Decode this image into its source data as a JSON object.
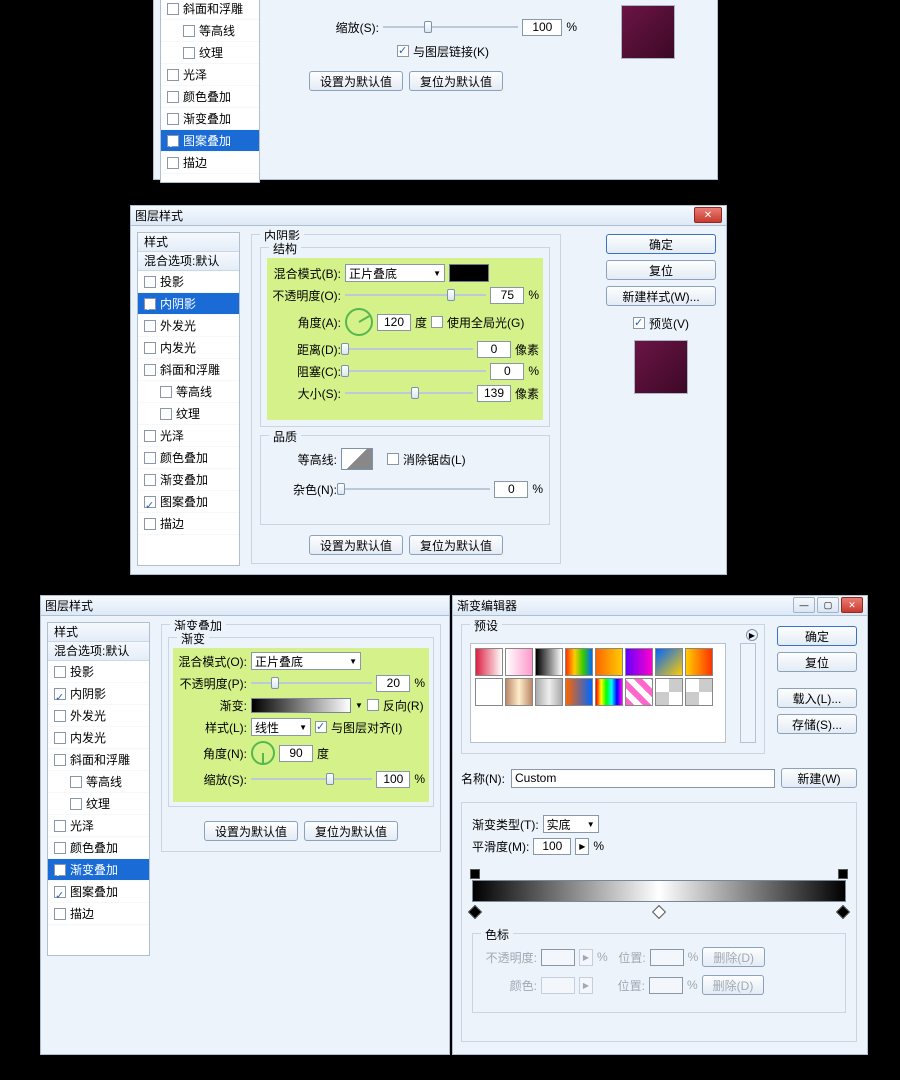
{
  "dlg1": {
    "sidebar": [
      {
        "label": "斜面和浮雕",
        "checked": false,
        "sel": false,
        "indent": false
      },
      {
        "label": "等高线",
        "checked": false,
        "sel": false,
        "indent": true
      },
      {
        "label": "纹理",
        "checked": false,
        "sel": false,
        "indent": true
      },
      {
        "label": "光泽",
        "checked": false,
        "sel": false,
        "indent": false
      },
      {
        "label": "颜色叠加",
        "checked": false,
        "sel": false,
        "indent": false
      },
      {
        "label": "渐变叠加",
        "checked": false,
        "sel": false,
        "indent": false
      },
      {
        "label": "图案叠加",
        "checked": true,
        "sel": true,
        "indent": false
      },
      {
        "label": "描边",
        "checked": false,
        "sel": false,
        "indent": false
      }
    ],
    "scale_label": "缩放(S):",
    "scale_value": "100",
    "pct": "%",
    "link_label": "与图层链接(K)",
    "reset_default": "设置为默认值",
    "restore_default": "复位为默认值"
  },
  "dlg2": {
    "title": "图层样式",
    "styles_label": "样式",
    "blend_default": "混合选项:默认",
    "effects": [
      {
        "label": "投影",
        "checked": false,
        "sel": false,
        "indent": false
      },
      {
        "label": "内阴影",
        "checked": true,
        "sel": true,
        "indent": false
      },
      {
        "label": "外发光",
        "checked": false,
        "sel": false,
        "indent": false
      },
      {
        "label": "内发光",
        "checked": false,
        "sel": false,
        "indent": false
      },
      {
        "label": "斜面和浮雕",
        "checked": false,
        "sel": false,
        "indent": false
      },
      {
        "label": "等高线",
        "checked": false,
        "sel": false,
        "indent": true
      },
      {
        "label": "纹理",
        "checked": false,
        "sel": false,
        "indent": true
      },
      {
        "label": "光泽",
        "checked": false,
        "sel": false,
        "indent": false
      },
      {
        "label": "颜色叠加",
        "checked": false,
        "sel": false,
        "indent": false
      },
      {
        "label": "渐变叠加",
        "checked": false,
        "sel": false,
        "indent": false
      },
      {
        "label": "图案叠加",
        "checked": true,
        "sel": false,
        "indent": false
      },
      {
        "label": "描边",
        "checked": false,
        "sel": false,
        "indent": false
      }
    ],
    "panel_title": "内阴影",
    "struct_title": "结构",
    "blend_mode_label": "混合模式(B):",
    "blend_mode_value": "正片叠底",
    "opacity_label": "不透明度(O):",
    "opacity_value": "75",
    "angle_label": "角度(A):",
    "angle_value": "120",
    "degree": "度",
    "global_label": "使用全局光(G)",
    "distance_label": "距离(D):",
    "distance_value": "0",
    "px": "像素",
    "choke_label": "阻塞(C):",
    "choke_value": "0",
    "size_label": "大小(S):",
    "size_value": "139",
    "quality_title": "品质",
    "contour_label": "等高线:",
    "antialias_label": "消除锯齿(L)",
    "noise_label": "杂色(N):",
    "noise_value": "0",
    "reset_default": "设置为默认值",
    "restore_default": "复位为默认值",
    "ok": "确定",
    "cancel": "复位",
    "newstyle": "新建样式(W)...",
    "preview_label": "预览(V)",
    "pct": "%"
  },
  "dlg3": {
    "title": "图层样式",
    "styles_label": "样式",
    "blend_default": "混合选项:默认",
    "effects": [
      {
        "label": "投影",
        "checked": false,
        "sel": false,
        "indent": false
      },
      {
        "label": "内阴影",
        "checked": true,
        "sel": false,
        "indent": false
      },
      {
        "label": "外发光",
        "checked": false,
        "sel": false,
        "indent": false
      },
      {
        "label": "内发光",
        "checked": false,
        "sel": false,
        "indent": false
      },
      {
        "label": "斜面和浮雕",
        "checked": false,
        "sel": false,
        "indent": false
      },
      {
        "label": "等高线",
        "checked": false,
        "sel": false,
        "indent": true
      },
      {
        "label": "纹理",
        "checked": false,
        "sel": false,
        "indent": true
      },
      {
        "label": "光泽",
        "checked": false,
        "sel": false,
        "indent": false
      },
      {
        "label": "颜色叠加",
        "checked": false,
        "sel": false,
        "indent": false
      },
      {
        "label": "渐变叠加",
        "checked": true,
        "sel": true,
        "indent": false
      },
      {
        "label": "图案叠加",
        "checked": true,
        "sel": false,
        "indent": false
      },
      {
        "label": "描边",
        "checked": false,
        "sel": false,
        "indent": false
      }
    ],
    "panel_title": "渐变叠加",
    "grad_title": "渐变",
    "blend_mode_label": "混合模式(O):",
    "blend_mode_value": "正片叠底",
    "opacity_label": "不透明度(P):",
    "opacity_value": "20",
    "gradient_label": "渐变:",
    "reverse_label": "反向(R)",
    "style_label": "样式(L):",
    "style_value": "线性",
    "align_label": "与图层对齐(I)",
    "angle_label": "角度(N):",
    "angle_value": "90",
    "degree": "度",
    "scale_label": "缩放(S):",
    "scale_value": "100",
    "pct": "%",
    "reset_default": "设置为默认值",
    "restore_default": "复位为默认值"
  },
  "grad": {
    "title": "渐变编辑器",
    "presets_title": "预设",
    "ok": "确定",
    "cancel": "复位",
    "load": "载入(L)...",
    "save": "存储(S)...",
    "name_label": "名称(N):",
    "name_value": "Custom",
    "new_btn": "新建(W)",
    "gradtype_label": "渐变类型(T):",
    "gradtype_value": "实底",
    "smooth_label": "平滑度(M):",
    "smooth_value": "100",
    "pct": "%",
    "stops_title": "色标",
    "opacity_label": "不透明度:",
    "opacity_unit": "%",
    "location_label": "位置:",
    "location_unit": "%",
    "delete_label": "删除(D)",
    "color_label": "颜色:",
    "preset_colors": [
      "linear-gradient(90deg,#d24,#fff)",
      "linear-gradient(90deg,#fff,#f9c)",
      "linear-gradient(90deg,#000,#fff)",
      "linear-gradient(90deg,#f30,#fc0,#3c0,#06f)",
      "linear-gradient(90deg,#f60,#fc0)",
      "linear-gradient(90deg,#60f,#f0c)",
      "linear-gradient(135deg,#06f,#fc0)",
      "linear-gradient(90deg,#fc0,#f30)",
      "#fff",
      "linear-gradient(90deg,#b86,#fec,#b86)",
      "linear-gradient(90deg,#aaa,#eee,#aaa)",
      "linear-gradient(90deg,#f60,#06f)",
      "linear-gradient(90deg,#f00,#ff0,#0f0,#0ff,#00f,#f0f)",
      "repeating-linear-gradient(45deg,#f6c 0 6px,#fff 6px 12px)",
      "repeating-conic-gradient(#ccc 0 25%,#fff 0 50%)",
      "repeating-conic-gradient(#ccc 0 25%,#fff 0 50%)"
    ]
  }
}
